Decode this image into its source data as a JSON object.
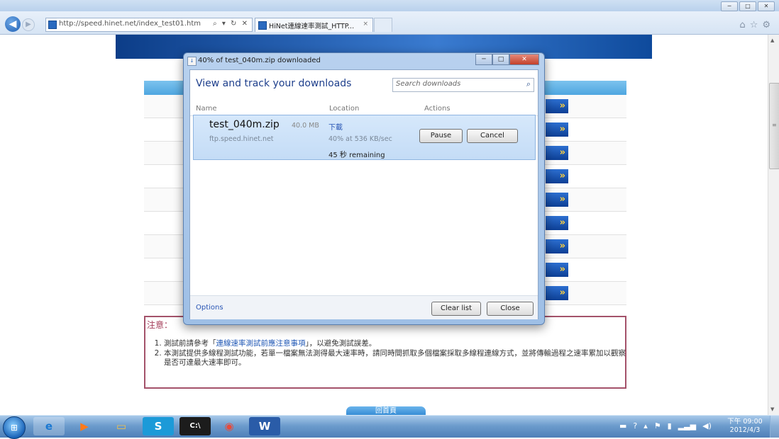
{
  "browser": {
    "url": "http://speed.hinet.net/index_test01.htm",
    "url_controls": "⌕ ▾ ↻ ✕",
    "tab_title": "HiNet連線速率測試_HTTP...",
    "tab_close": "×",
    "window_controls": [
      "─",
      "□",
      "✕"
    ],
    "tool_icons": [
      "⌂",
      "☆",
      "⚙"
    ]
  },
  "page": {
    "row_button_glyph": "»",
    "notice_title": "注意：",
    "notice_items": [
      {
        "before": "測試前請參考「",
        "link": "連線速率測試前應注意事項",
        "after": "」，以避免測試誤差。"
      },
      {
        "before": "本測試提供多線程測試功能，若單一檔案無法測得最大速率時，請同時間抓取多個檔案採取多線程連線方式，並將傳輸過程之速率累加以觀察是否可達最大速率即可。",
        "link": "",
        "after": ""
      }
    ],
    "home_button": "回首頁"
  },
  "dialog": {
    "title": "40% of test_040m.zip downloaded",
    "heading": "View and track your downloads",
    "search_placeholder": "Search downloads",
    "columns": {
      "name": "Name",
      "location": "Location",
      "actions": "Actions"
    },
    "item": {
      "file_name": "test_040m.zip",
      "file_size": "40.0 MB",
      "source": "ftp.speed.hinet.net",
      "location": "下載",
      "progress_text": "40% at 536 KB/sec",
      "remaining": "45 秒 remaining",
      "progress_percent": 40
    },
    "pause_label": "Pause",
    "cancel_label": "Cancel",
    "options_label": "Options",
    "clear_list_label": "Clear list",
    "close_label": "Close"
  },
  "taskbar": {
    "apps": [
      "internet-explorer",
      "media-player",
      "file-explorer",
      "skype",
      "command-prompt",
      "chrome",
      "word"
    ],
    "clock_time": "下午 09:00",
    "clock_date": "2012/4/3"
  }
}
